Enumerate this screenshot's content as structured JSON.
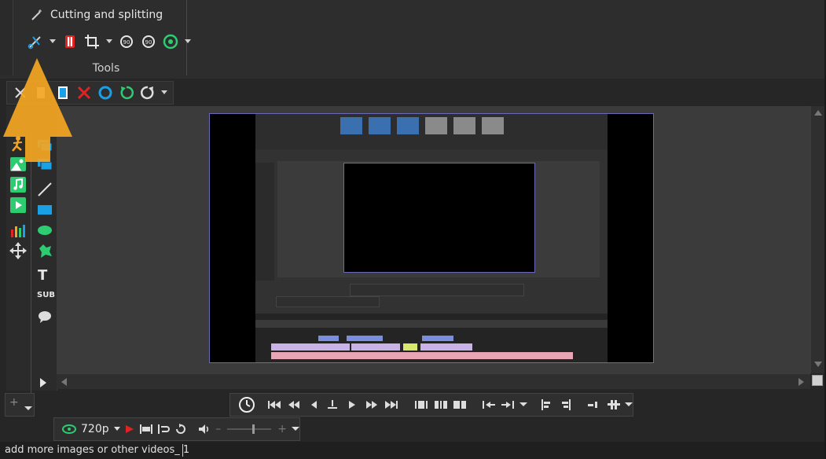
{
  "ribbon": {
    "group_title": "Cutting and splitting",
    "group_label": "Tools",
    "tool_icons": [
      "scissors-icon",
      "split-icon",
      "crop-icon",
      "rotate-ccw-90-icon",
      "rotate-cw-90-icon",
      "speed-icon"
    ]
  },
  "edit_toolbar": {
    "icons": [
      "cut-icon",
      "copy-icon",
      "paste-icon",
      "delete-icon",
      "record-icon",
      "undo-icon",
      "redo-icon"
    ]
  },
  "left_tools": {
    "col1": [
      "person-icon",
      "image-icon",
      "music-icon",
      "video-icon",
      "equalizer-icon",
      "move-icon"
    ],
    "col2": [
      "layers-icon",
      "line-icon",
      "rect-icon",
      "ellipse-icon",
      "blob-icon",
      "text-icon",
      "sub-icon",
      "speech-bubble-icon"
    ],
    "text_label": "T",
    "sub_label": "SUB"
  },
  "output": {
    "resolution": "720p"
  },
  "status": {
    "clip_name": "add more images or other videos_ 1"
  },
  "colors": {
    "accent_green": "#2ecc71",
    "delete_red": "#e02424",
    "record_blue": "#1aa0e6",
    "arrow_yellow": "#f5a623"
  }
}
